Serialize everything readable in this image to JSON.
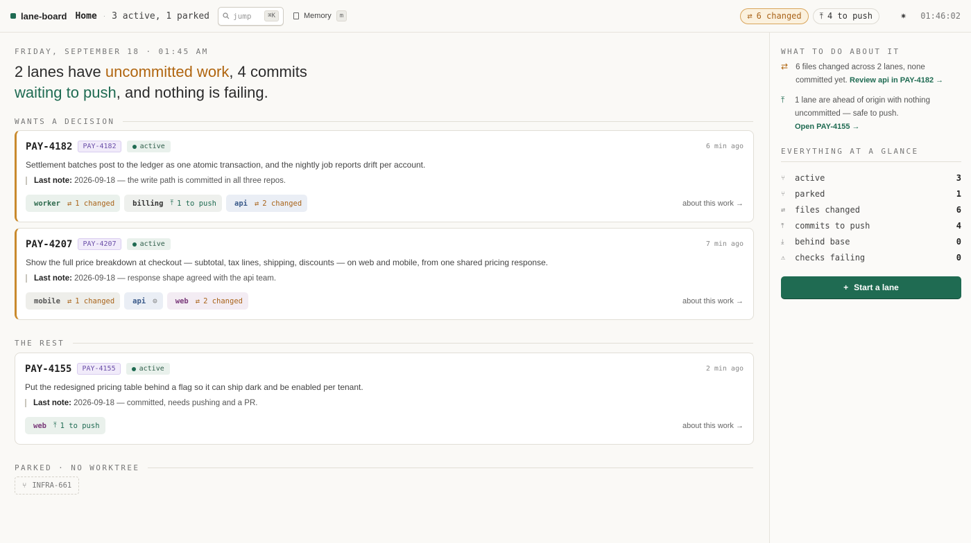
{
  "topbar": {
    "brand": "lane-board",
    "home": "Home",
    "summary": "3 active, 1 parked",
    "jump_placeholder": "jump",
    "jump_shortcut": "⌘K",
    "memory_label": "Memory",
    "memory_shortcut": "m",
    "changed_pill": "6 changed",
    "push_pill": "4 to push",
    "clock": "01:46:02"
  },
  "main": {
    "date_line": "FRIDAY, SEPTEMBER 18 · 01:45 AM",
    "headline": {
      "p1": "2 lanes have ",
      "p2": "uncommitted work",
      "p3": ", 4 commits ",
      "p4": "waiting to push",
      "p5": ", and nothing is failing."
    },
    "sections": {
      "decision": "WANTS A DECISION",
      "rest": "THE REST",
      "parked": "PARKED · NO WORKTREE"
    },
    "cards": [
      {
        "id": "PAY-4182",
        "tag": "PAY-4182",
        "status": "active",
        "time": "6 min ago",
        "desc": "Settlement batches post to the ledger as one atomic transaction, and the nightly job reports drift per account.",
        "note_label": "Last note:",
        "note": " 2026-09-18 — the write path is committed in all three repos.",
        "chips": [
          {
            "repo": "worker",
            "state": "1 changed"
          },
          {
            "repo": "billing",
            "state": "1 to push"
          },
          {
            "repo": "api",
            "state": "2 changed"
          }
        ],
        "about": "about this work →"
      },
      {
        "id": "PAY-4207",
        "tag": "PAY-4207",
        "status": "active",
        "time": "7 min ago",
        "desc": "Show the full price breakdown at checkout — subtotal, tax lines, shipping, discounts — on web and mobile, from one shared pricing response.",
        "note_label": "Last note:",
        "note": " 2026-09-18 — response shape agreed with the api team.",
        "chips": [
          {
            "repo": "mobile",
            "state": "1 changed"
          },
          {
            "repo": "api",
            "state": ""
          },
          {
            "repo": "web",
            "state": "2 changed"
          }
        ],
        "about": "about this work →"
      },
      {
        "id": "PAY-4155",
        "tag": "PAY-4155",
        "status": "active",
        "time": "2 min ago",
        "desc": "Put the redesigned pricing table behind a flag so it can ship dark and be enabled per tenant.",
        "note_label": "Last note:",
        "note": " 2026-09-18 — committed, needs pushing and a PR.",
        "chips": [
          {
            "repo": "web",
            "state": "1 to push"
          }
        ],
        "about": "about this work →"
      }
    ],
    "parked_item": "INFRA-661"
  },
  "sidebar": {
    "todo_label": "WHAT TO DO ABOUT IT",
    "todo": [
      {
        "text": "6 files changed across 2 lanes, none committed yet.",
        "link": "Review api in PAY-4182 →"
      },
      {
        "text": "1 lane are ahead of origin with nothing uncommitted — safe to push.",
        "link": "Open PAY-4155 →"
      }
    ],
    "glance_label": "EVERYTHING AT A GLANCE",
    "stats": [
      {
        "label": "active",
        "value": "3"
      },
      {
        "label": "parked",
        "value": "1"
      },
      {
        "label": "files changed",
        "value": "6"
      },
      {
        "label": "commits to push",
        "value": "4"
      },
      {
        "label": "behind base",
        "value": "0"
      },
      {
        "label": "checks failing",
        "value": "0"
      }
    ],
    "start_button": "Start a lane"
  }
}
